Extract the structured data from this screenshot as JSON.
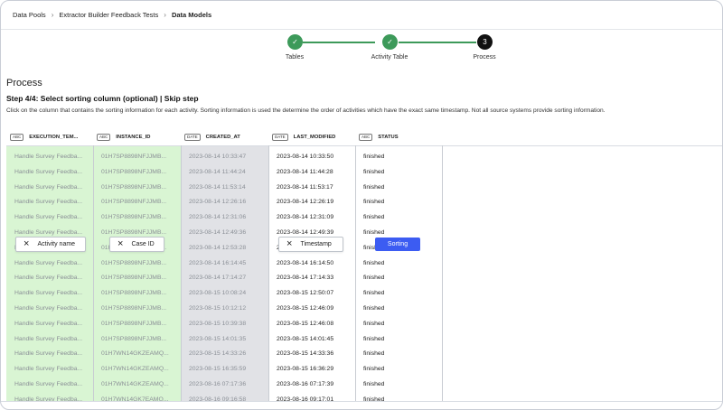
{
  "breadcrumb": {
    "items": [
      "Data Pools",
      "Extractor Builder Feedback Tests",
      "Data Models"
    ]
  },
  "stepper": {
    "steps": [
      {
        "label": "Tables",
        "state": "done",
        "mark": "✓"
      },
      {
        "label": "Activity Table",
        "state": "done",
        "mark": "✓"
      },
      {
        "label": "Process",
        "state": "active",
        "mark": "3"
      }
    ]
  },
  "page": {
    "title": "Process",
    "step_heading": "Step 4/4: Select sorting column (optional)",
    "divider": "|",
    "skip_label": "Skip step",
    "description": "Click on the column that contains the sorting information for each activity. Sorting information is used the determine the order of activities which have the exact same timestamp. Not all source systems provide sorting information."
  },
  "table": {
    "columns": [
      {
        "type": "ABC",
        "name": "EXECUTION_TEM..."
      },
      {
        "type": "ABC",
        "name": "INSTANCE_ID"
      },
      {
        "type": "DATE",
        "name": "CREATED_AT"
      },
      {
        "type": "DATE",
        "name": "LAST_MODIFIED"
      },
      {
        "type": "ABC",
        "name": "STATUS"
      }
    ],
    "rows": [
      [
        "Handle Survey Feedba...",
        "01H7SP8898NFJJMB...",
        "2023-08-14 10:33:47",
        "2023-08-14 10:33:50",
        "finished"
      ],
      [
        "Handle Survey Feedba...",
        "01H7SP8898NFJJMB...",
        "2023-08-14 11:44:24",
        "2023-08-14 11:44:28",
        "finished"
      ],
      [
        "Handle Survey Feedba...",
        "01H7SP8898NFJJMB...",
        "2023-08-14 11:53:14",
        "2023-08-14 11:53:17",
        "finished"
      ],
      [
        "Handle Survey Feedba...",
        "01H7SP8898NFJJMB...",
        "2023-08-14 12:26:16",
        "2023-08-14 12:26:19",
        "finished"
      ],
      [
        "Handle Survey Feedba...",
        "01H7SP8898NFJJMB...",
        "2023-08-14 12:31:06",
        "2023-08-14 12:31:09",
        "finished"
      ],
      [
        "Handle Survey Feedba...",
        "01H7SP8898NFJJMB...",
        "2023-08-14 12:49:36",
        "2023-08-14 12:49:39",
        "finished"
      ],
      [
        "Handle Survey Feedba...",
        "01H7SP8898NFJJMB...",
        "2023-08-14 12:53:28",
        "2023-08-14 12:53:31",
        "finished"
      ],
      [
        "Handle Survey Feedba...",
        "01H7SP8898NFJJMB...",
        "2023-08-14 16:14:45",
        "2023-08-14 16:14:50",
        "finished"
      ],
      [
        "Handle Survey Feedba...",
        "01H7SP8898NFJJMB...",
        "2023-08-14 17:14:27",
        "2023-08-14 17:14:33",
        "finished"
      ],
      [
        "Handle Survey Feedba...",
        "01H7SP8898NFJJMB...",
        "2023-08-15 10:08:24",
        "2023-08-15 12:50:07",
        "finished"
      ],
      [
        "Handle Survey Feedba...",
        "01H7SP8898NFJJMB...",
        "2023-08-15 10:12:12",
        "2023-08-15 12:46:09",
        "finished"
      ],
      [
        "Handle Survey Feedba...",
        "01H7SP8898NFJJMB...",
        "2023-08-15 10:39:38",
        "2023-08-15 12:46:08",
        "finished"
      ],
      [
        "Handle Survey Feedba...",
        "01H7SP8898NFJJMB...",
        "2023-08-15 14:01:35",
        "2023-08-15 14:01:45",
        "finished"
      ],
      [
        "Handle Survey Feedba...",
        "01H7WN14GKZEAMQ...",
        "2023-08-15 14:33:26",
        "2023-08-15 14:33:36",
        "finished"
      ],
      [
        "Handle Survey Feedba...",
        "01H7WN14GKZEAMQ...",
        "2023-08-15 16:35:59",
        "2023-08-15 16:36:29",
        "finished"
      ],
      [
        "Handle Survey Feedba...",
        "01H7WN14GKZEAMQ...",
        "2023-08-16 07:17:36",
        "2023-08-16 07:17:39",
        "finished"
      ],
      [
        "Handle Survey Feedba...",
        "01H7WN14GK7EAMQ...",
        "2023-08-16 09:16:58",
        "2023-08-16 09:17:01",
        "finished"
      ]
    ]
  },
  "mappings": {
    "activity_name": {
      "remove": "×",
      "label": "Activity name"
    },
    "case_id": {
      "remove": "×",
      "label": "Case ID"
    },
    "timestamp": {
      "remove": "×",
      "label": "Timestamp"
    },
    "sorting": {
      "label": "Sorting"
    }
  },
  "colors": {
    "mapped_column": "#d9f5d3",
    "timestamp_column": "#e1e2e6",
    "step_done": "#3d9a5a",
    "step_active": "#111111",
    "sorting_button": "#3c5cf2"
  }
}
